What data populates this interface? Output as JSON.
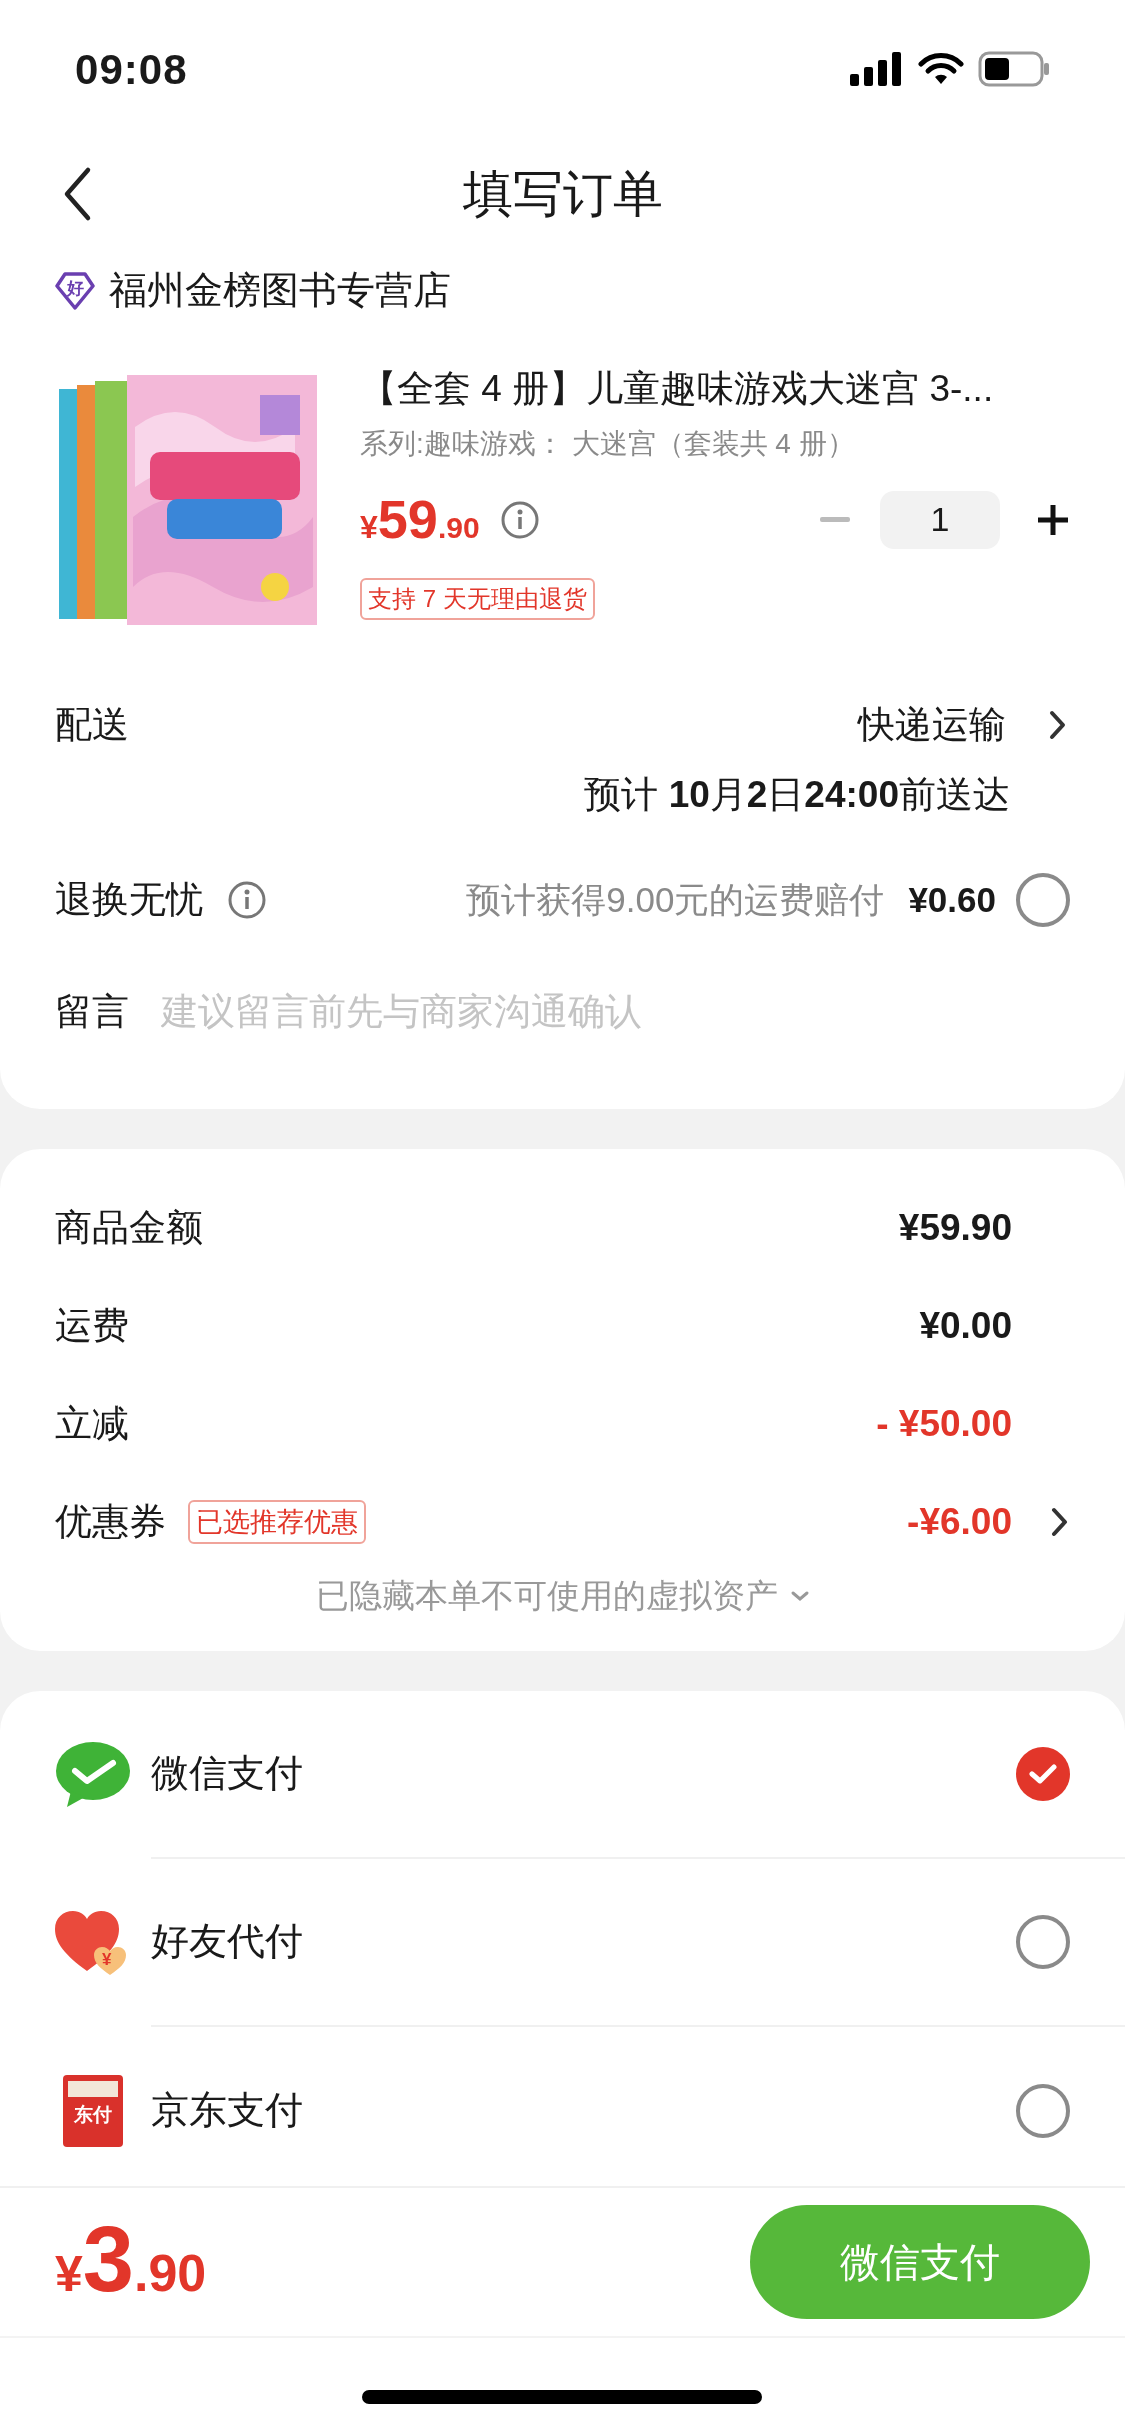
{
  "status_bar": {
    "time": "09:08"
  },
  "header": {
    "title": "填写订单"
  },
  "store": {
    "badge": "好",
    "name": "福州金榜图书专营店"
  },
  "product": {
    "title": "【全套 4 册】儿童趣味游戏大迷宫 3-...",
    "variant": "系列:趣味游戏： 大迷宫（套装共 4 册）",
    "currency": "¥",
    "price_int": "59",
    "price_dec": ".90",
    "quantity": "1",
    "tag": "支持 7 天无理由退货"
  },
  "delivery": {
    "label": "配送",
    "method": "快递运输",
    "eta": "预计 **10**月**2**日**24:00**前送达"
  },
  "return_insurance": {
    "label": "退换无忧",
    "note": "预计获得9.00元的运费赔付",
    "price": "¥0.60",
    "checked": false
  },
  "message": {
    "label": "留言",
    "placeholder": "建议留言前先与商家沟通确认"
  },
  "summary": [
    {
      "label": "商品金额",
      "value": "¥59.90",
      "kind": "plain",
      "chevron": false
    },
    {
      "label": "运费",
      "value": "¥0.00",
      "kind": "plain",
      "chevron": false
    },
    {
      "label": "立减",
      "value": "- ¥50.00",
      "kind": "discount",
      "chevron": false
    },
    {
      "label": "优惠券",
      "tag": "已选推荐优惠",
      "value": "-¥6.00",
      "kind": "discount",
      "chevron": true
    }
  ],
  "hidden_note": "已隐藏本单不可使用的虚拟资产",
  "payment": [
    {
      "kind": "wechat",
      "label": "微信支付",
      "selected": true
    },
    {
      "kind": "friend",
      "label": "好友代付",
      "icon_text": "¥",
      "selected": false
    },
    {
      "kind": "jd",
      "label": "京东支付",
      "icon_text": "东付",
      "selected": false
    }
  ],
  "footer": {
    "currency": "¥",
    "price_int": "3",
    "price_dec": ".90",
    "button": "微信支付"
  }
}
